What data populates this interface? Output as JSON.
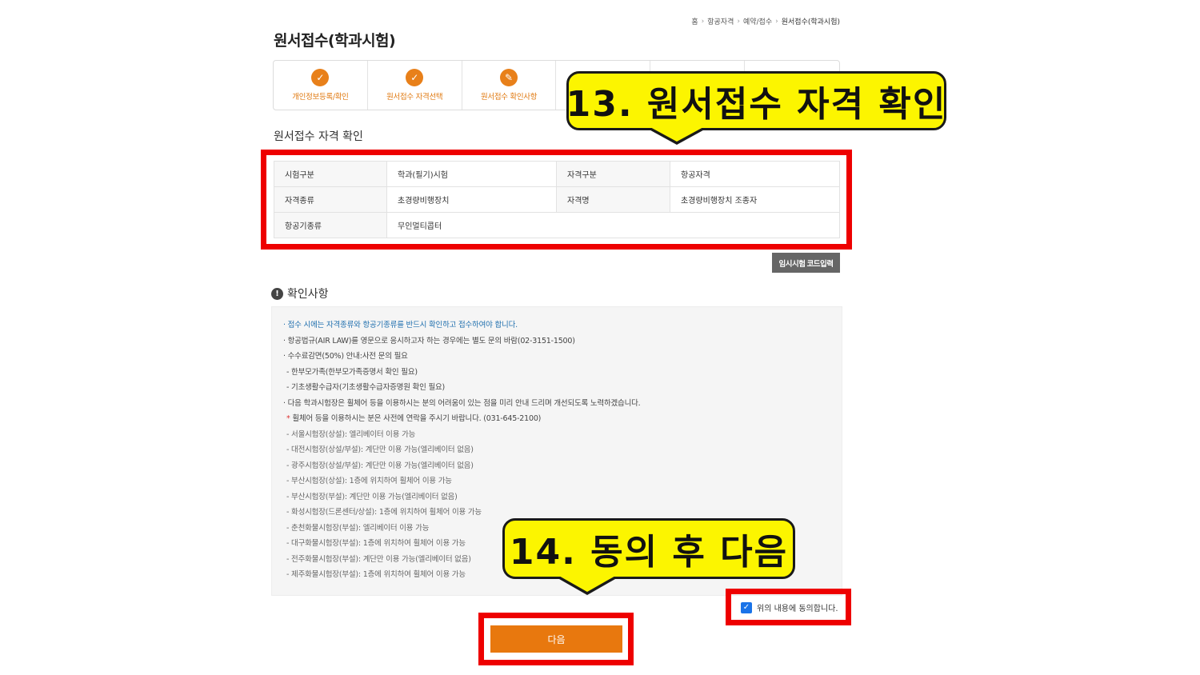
{
  "breadcrumb": {
    "home": "홈",
    "level1": "항공자격",
    "level2": "예약/접수",
    "current": "원서접수(학과시험)"
  },
  "page_title": "원서접수(학과시험)",
  "steps": [
    {
      "label": "개인정보등록/확인",
      "icon": "check-icon",
      "state": "done"
    },
    {
      "label": "원서접수 자격선택",
      "icon": "check-icon",
      "state": "done"
    },
    {
      "label": "원서접수 확인사항",
      "icon": "pencil-icon",
      "state": "current"
    },
    {
      "label": "",
      "icon": "",
      "state": "pending"
    },
    {
      "label": "",
      "icon": "",
      "state": "pending"
    },
    {
      "label": "",
      "icon": "",
      "state": "pending"
    }
  ],
  "section_title": "원서접수 자격 확인",
  "info_table": {
    "exam_type_label": "시험구분",
    "exam_type_value": "학과(필기)시험",
    "qual_type_label": "자격구분",
    "qual_type_value": "항공자격",
    "qual_kind_label": "자격종류",
    "qual_kind_value": "초경량비행장치",
    "qual_name_label": "자격명",
    "qual_name_value": "초경량비행장치 조종자",
    "aircraft_label": "항공기종류",
    "aircraft_value": "무인멀티콥터"
  },
  "code_button": "임시시험 코드입력",
  "notice": {
    "title": "확인사항",
    "lines": [
      "· 접수 시에는 자격종류와 항공기종류를 반드시 확인하고 접수하여야 합니다.",
      "· 항공법규(AIR LAW)를 영문으로 응시하고자 하는 경우에는 별도 문의 바람(02-3151-1500)",
      "· 수수료감면(50%) 안내:사전 문의 필요",
      "- 한부모가족(한부모가족증명서 확인 필요)",
      "- 기초생활수급자(기초생활수급자증명원 확인 필요)",
      "· 다음 학과시험장은 휠체어 등을 이용하시는 분의 어려움이 있는 점을 미리 안내 드리며 개선되도록 노력하겠습니다.",
      "휠체어 등을 이용하시는 분은 사전에 연락을 주시기 바랍니다. (031-645-2100)",
      "- 서울시험장(상설): 엘리베이터 이용 가능",
      "- 대전시험장(상설/부설): 계단만 이용 가능(엘리베이터 없음)",
      "- 광주시험장(상설/부설): 계단만 이용 가능(엘리베이터 없음)",
      "- 부산시험장(상설): 1층에 위치하여 휠체어 이용 가능",
      "- 부산시험장(부설): 계단만 이용 가능(엘리베이터 없음)",
      "- 화성시험장(드론센터/상설): 1층에 위치하여 휠체어 이용 가능",
      "- 춘천화물시험장(부설): 엘리베이터 이용 가능",
      "- 대구화물시험장(부설): 1층에 위치하여 휠체어 이용 가능",
      "- 전주화물시험장(부설): 계단만 이용 가능(엘리베이터 없음)",
      "- 제주화물시험장(부설): 1층에 위치하여 휠체어 이용 가능"
    ],
    "star": "*"
  },
  "agree_label": "위의 내용에 동의합니다.",
  "next_button": "다음",
  "callouts": {
    "c13": "13. 원서접수 자격 확인",
    "c14": "14. 동의 후 다음"
  },
  "colors": {
    "accent": "#e8780e",
    "highlight_red": "#ee0000",
    "callout_yellow": "#fcf500",
    "notice_blue": "#1f6fae"
  }
}
